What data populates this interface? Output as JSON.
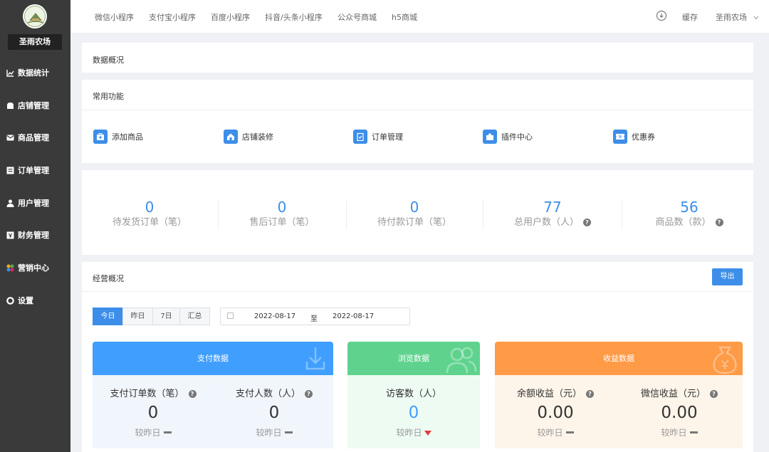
{
  "sidebar": {
    "store_name": "圣雨农场",
    "items": [
      {
        "label": "数据统计"
      },
      {
        "label": "店铺管理"
      },
      {
        "label": "商品管理"
      },
      {
        "label": "订单管理"
      },
      {
        "label": "用户管理"
      },
      {
        "label": "财务管理"
      },
      {
        "label": "营销中心"
      },
      {
        "label": "设置"
      }
    ]
  },
  "topbar": {
    "links": [
      "微信小程序",
      "支付宝小程序",
      "百度小程序",
      "抖音/头条小程序",
      "公众号商城",
      "h5商城"
    ],
    "cache": "缓存",
    "account": "圣雨农场"
  },
  "overview": {
    "title": "数据概况"
  },
  "functions": {
    "title": "常用功能",
    "items": [
      {
        "label": "添加商品",
        "icon": "bag-plus-icon"
      },
      {
        "label": "店铺装修",
        "icon": "house-icon"
      },
      {
        "label": "订单管理",
        "icon": "clipboard-check-icon"
      },
      {
        "label": "插件中心",
        "icon": "puzzle-icon"
      },
      {
        "label": "优惠券",
        "icon": "ticket-icon"
      }
    ]
  },
  "stats": [
    {
      "value": "0",
      "label": "待发货订单（笔）"
    },
    {
      "value": "0",
      "label": "售后订单（笔）"
    },
    {
      "value": "0",
      "label": "待付款订单（笔）"
    },
    {
      "value": "77",
      "label": "总用户数（人）"
    },
    {
      "value": "56",
      "label": "商品数（款）"
    }
  ],
  "business": {
    "title": "经营概况",
    "export": "导出",
    "periods": [
      "今日",
      "昨日",
      "7日",
      "汇总"
    ],
    "date_start": "2022-08-17",
    "date_sep": "至",
    "date_end": "2022-08-17",
    "panels": [
      {
        "title": "支付数据",
        "color": "#409eff",
        "metrics": [
          {
            "label": "支付订单数（笔）",
            "value": "0",
            "cmp": "较昨日"
          },
          {
            "label": "支付人数（人）",
            "value": "0",
            "cmp": "较昨日"
          }
        ]
      },
      {
        "title": "浏览数据",
        "color": "#5fd38e",
        "metrics": [
          {
            "label": "访客数（人）",
            "value": "0",
            "cmp": "较昨日"
          }
        ]
      },
      {
        "title": "收益数据",
        "color": "#ff9a46",
        "metrics": [
          {
            "label": "余额收益（元）",
            "value": "0.00",
            "cmp": "较昨日"
          },
          {
            "label": "微信收益（元）",
            "value": "0.00",
            "cmp": "较昨日"
          }
        ]
      }
    ]
  }
}
